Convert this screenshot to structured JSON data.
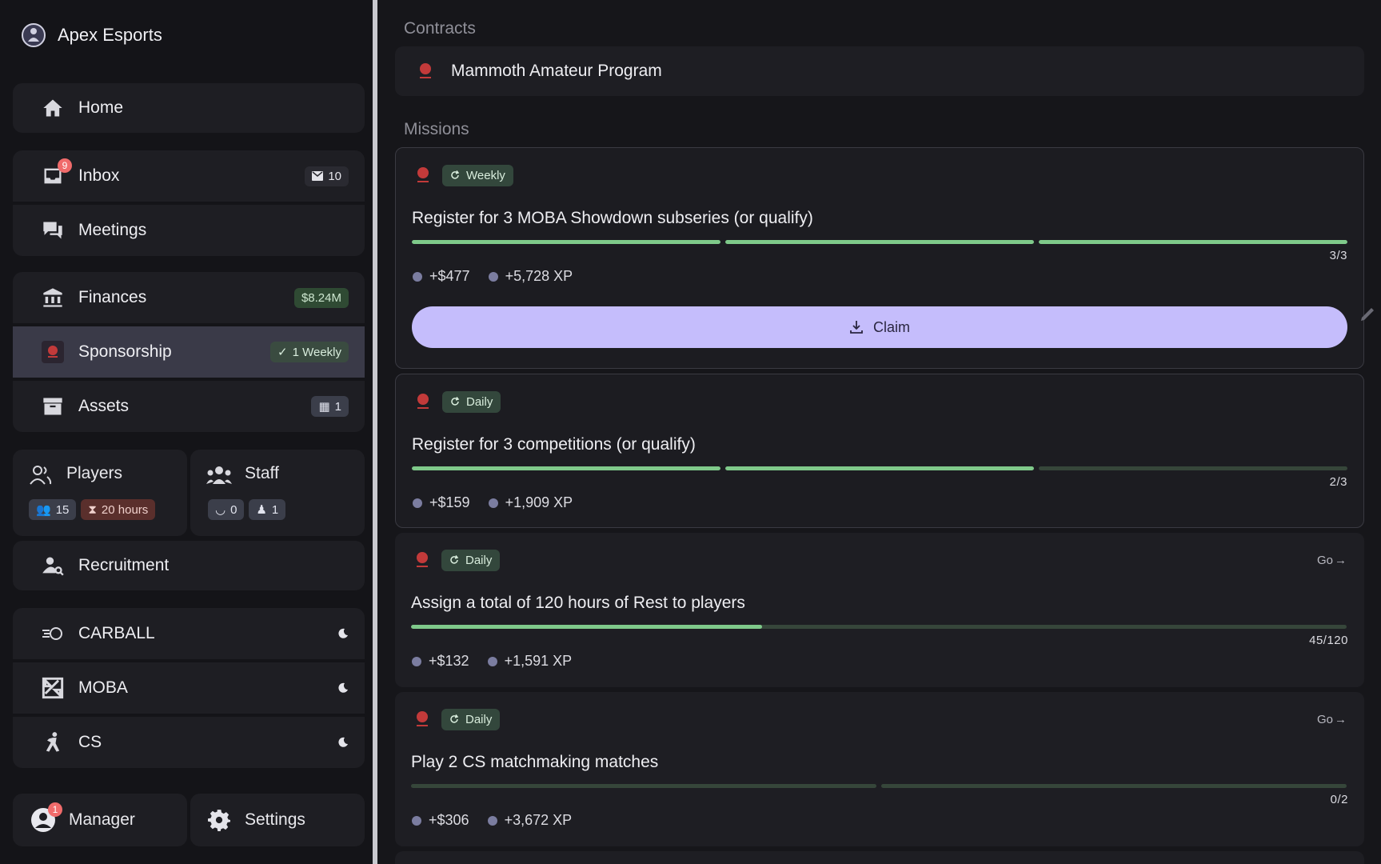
{
  "app": {
    "name": "Apex Esports"
  },
  "sidebar": {
    "home": "Home",
    "inbox": {
      "label": "Inbox",
      "badge": "9",
      "count": "10"
    },
    "meetings": "Meetings",
    "finances": {
      "label": "Finances",
      "value": "$8.24M"
    },
    "sponsorship": {
      "label": "Sponsorship",
      "status": "1 Weekly"
    },
    "assets": {
      "label": "Assets",
      "count": "1"
    },
    "players": {
      "label": "Players",
      "count": "15",
      "hours": "20 hours"
    },
    "staff": {
      "label": "Staff",
      "scouts": "0",
      "members": "1"
    },
    "recruitment": "Recruitment",
    "games": [
      {
        "label": "CARBALL"
      },
      {
        "label": "MOBA"
      },
      {
        "label": "CS"
      }
    ],
    "manager": {
      "label": "Manager",
      "badge": "1"
    },
    "settings": "Settings"
  },
  "main": {
    "contracts_title": "Contracts",
    "contract_name": "Mammoth Amateur Program",
    "missions_title": "Missions",
    "claim_label": "Claim",
    "go_label": "Go",
    "missions": [
      {
        "tag": "Weekly",
        "title": "Register for 3 MOBA Showdown subseries (or qualify)",
        "progress": "3/3",
        "money": "+$477",
        "xp": "+5,728 XP",
        "segments": 3,
        "done": 3
      },
      {
        "tag": "Daily",
        "title": "Register for 3 competitions (or qualify)",
        "progress": "2/3",
        "money": "+$159",
        "xp": "+1,909 XP",
        "segments": 3,
        "done": 2
      },
      {
        "tag": "Daily",
        "title": "Assign a total of 120 hours of Rest to players",
        "progress": "45/120",
        "money": "+$132",
        "xp": "+1,591 XP",
        "fraction": 0.375
      },
      {
        "tag": "Daily",
        "title": "Play 2 CS matchmaking matches",
        "progress": "0/2",
        "money": "+$306",
        "xp": "+3,672 XP",
        "segments": 2,
        "done": 0
      }
    ]
  },
  "colors": {
    "accent": "#c5bdfc",
    "progress": "#7fc98a",
    "track": "#36463a",
    "badge_red": "#f06b6b"
  }
}
